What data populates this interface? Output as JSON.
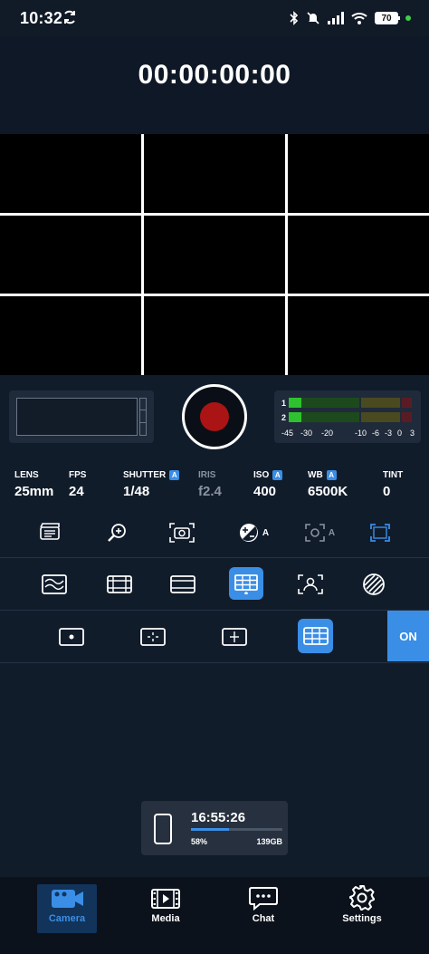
{
  "status_bar": {
    "time": "10:32",
    "battery": "70",
    "icons": [
      "sync-icon",
      "bluetooth-icon",
      "mute-icon",
      "signal-icon",
      "wifi-icon",
      "battery-icon"
    ]
  },
  "timecode": "00:00:00:00",
  "meters": {
    "channels": [
      "1",
      "2"
    ],
    "scale": [
      "-45",
      "-30",
      "-20",
      "-10",
      "-6",
      "-3",
      "0",
      "3"
    ],
    "colors": {
      "green": "#2ec32e",
      "dark_green": "#1d4a1d",
      "olive": "#4a4a20",
      "dark_red": "#5a1c24"
    }
  },
  "record": {
    "icon": "record-icon"
  },
  "camera_params": [
    {
      "label": "LENS",
      "value": "25mm",
      "auto": false,
      "disabled": false
    },
    {
      "label": "FPS",
      "value": "24",
      "auto": false,
      "disabled": false
    },
    {
      "label": "SHUTTER",
      "value": "1/48",
      "auto": true,
      "disabled": false
    },
    {
      "label": "IRIS",
      "value": "f2.4",
      "auto": false,
      "disabled": true
    },
    {
      "label": "ISO",
      "value": "400",
      "auto": true,
      "disabled": false
    },
    {
      "label": "WB",
      "value": "6500K",
      "auto": true,
      "disabled": false
    },
    {
      "label": "TINT",
      "value": "0",
      "auto": false,
      "disabled": false
    }
  ],
  "auto_badge": "A",
  "tool_row": {
    "exposure_suffix": "A",
    "focus_suffix": "A",
    "icons": [
      "clapper-icon",
      "zoom-in-icon",
      "camera-frame-icon",
      "exposure-comp-icon",
      "auto-focus-icon",
      "frame-guide-icon"
    ]
  },
  "overlay_row": {
    "icons": [
      "waveform-icon",
      "frame-lines-icon",
      "aspect-ratio-icon",
      "grid-icon",
      "face-detect-icon",
      "zebra-icon"
    ],
    "selected": "grid-icon"
  },
  "guide_row": {
    "icons": [
      "center-dot-icon",
      "crosshair-icon",
      "center-cross-icon",
      "grid-hash-icon"
    ],
    "selected": "grid-hash-icon",
    "toggle_label": "ON"
  },
  "storage": {
    "time_remaining": "16:55:26",
    "percent": "58%",
    "percent_value": 0.42,
    "capacity": "139GB"
  },
  "nav": [
    {
      "label": "Camera",
      "icon": "video-camera-icon",
      "active": true
    },
    {
      "label": "Media",
      "icon": "film-icon",
      "active": false
    },
    {
      "label": "Chat",
      "icon": "chat-icon",
      "active": false
    },
    {
      "label": "Settings",
      "icon": "gear-icon",
      "active": false
    }
  ],
  "accent": "#3a8ee6"
}
